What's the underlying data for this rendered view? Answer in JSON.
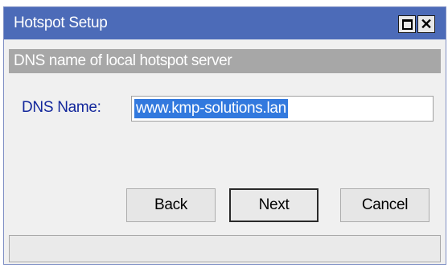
{
  "window": {
    "title": "Hotspot Setup"
  },
  "header": {
    "text": "DNS name of local hotspot server"
  },
  "form": {
    "dns_label": "DNS Name:",
    "dns_value": "www.kmp-solutions.lan"
  },
  "buttons": {
    "back": "Back",
    "next": "Next",
    "cancel": "Cancel"
  },
  "colors": {
    "titlebar": "#4c6bb8",
    "header_bar": "#a7a7a7",
    "label_text": "#14289c",
    "selection": "#3279de"
  }
}
